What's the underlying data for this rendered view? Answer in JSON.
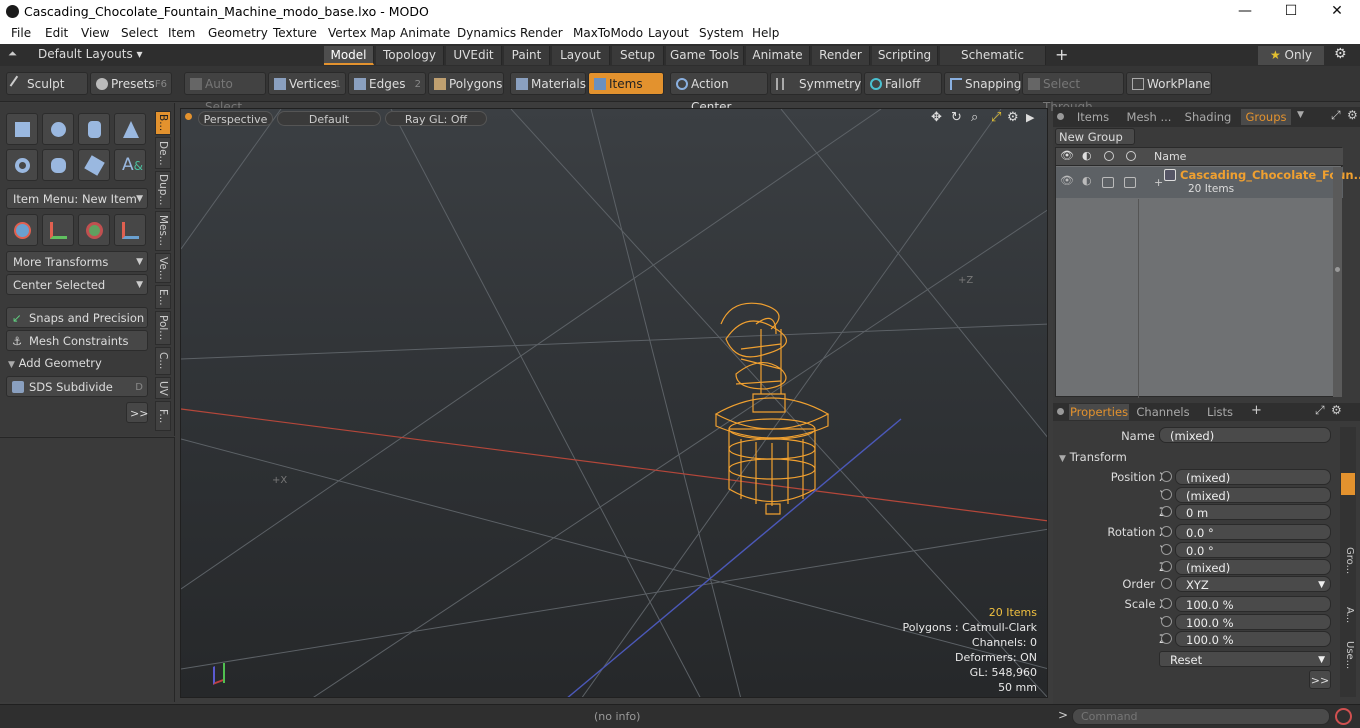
{
  "window": {
    "title": "Cascading_Chocolate_Fountain_Machine_modo_base.lxo - MODO",
    "min": "—",
    "max": "☐",
    "close": "✕"
  },
  "menu": [
    "File",
    "Edit",
    "View",
    "Select",
    "Item",
    "Geometry",
    "Texture",
    "Vertex Map",
    "Animate",
    "Dynamics",
    "Render",
    "MaxToModo",
    "Layout",
    "System",
    "Help"
  ],
  "modebar": {
    "layouts": "Default Layouts",
    "tabs": [
      "Model",
      "Topology",
      "UVEdit",
      "Paint",
      "Layout",
      "Setup",
      "Game Tools",
      "Animate",
      "Render",
      "Scripting",
      "Schematic Fusion"
    ],
    "plus": "+",
    "only": "Only"
  },
  "toolbar": {
    "sculpt": "Sculpt",
    "presets": "Presets",
    "presets_key": "F6",
    "auto_select": "Auto Select",
    "vertices": "Vertices",
    "vertices_key": "1",
    "edges": "Edges",
    "edges_key": "2",
    "polygons": "Polygons",
    "materials": "Materials",
    "items": "Items",
    "action_center": "Action Center",
    "symmetry": "Symmetry",
    "falloff": "Falloff",
    "snapping": "Snapping",
    "select_through": "Select Through",
    "workplane": "WorkPlane"
  },
  "left": {
    "item_menu": "Item Menu: New Item",
    "more_transforms": "More Transforms",
    "center_selected": "Center Selected",
    "snaps": "Snaps and Precision",
    "mesh_constraints": "Mesh Constraints",
    "add_geometry": "Add Geometry",
    "sds": "SDS Subdivide",
    "sds_key": "D",
    "more": ">>",
    "vtabs": [
      "B...",
      "De...",
      "Dup...",
      "Mes...",
      "Ve...",
      "E...",
      "Pol...",
      "C...",
      "UV",
      "F..."
    ]
  },
  "viewport": {
    "perspective": "Perspective",
    "default": "Default",
    "raygl": "Ray GL: Off",
    "axis_z": "+Z",
    "axis_x": "+X",
    "info": {
      "items": "20 Items",
      "polygons": "Polygons : Catmull-Clark",
      "channels": "Channels: 0",
      "deformers": "Deformers: ON",
      "gl": "GL: 548,960",
      "focal": "50 mm"
    }
  },
  "groups": {
    "tabs": [
      "Items",
      "Mesh ...",
      "Shading",
      "Groups"
    ],
    "new_group": "New Group",
    "col_name": "Name",
    "row_name": "Cascading_Chocolate_Foun...",
    "row_sub": "20 Items"
  },
  "properties": {
    "tabs": [
      "Properties",
      "Channels",
      "Lists"
    ],
    "plus": "+",
    "name_label": "Name",
    "name_val": "(mixed)",
    "transform": "Transform",
    "pos_label": "Position X",
    "pos": [
      "(mixed)",
      "(mixed)",
      "0 m"
    ],
    "rot_label": "Rotation X",
    "rot": [
      "0.0 °",
      "0.0 °",
      "(mixed)"
    ],
    "order_label": "Order",
    "order": "XYZ",
    "scale_label": "Scale X",
    "scale": [
      "100.0 %",
      "100.0 %",
      "100.0 %"
    ],
    "y": "Y",
    "z": "Z",
    "reset": "Reset",
    "more": ">>",
    "side_tabs": [
      "Gro...",
      "A...",
      "Use..."
    ]
  },
  "status": {
    "info": "(no info)",
    "command_placeholder": "Command",
    "prompt": ">"
  },
  "colors": {
    "accent": "#e3922e",
    "selected_wire": "#f0a030"
  }
}
